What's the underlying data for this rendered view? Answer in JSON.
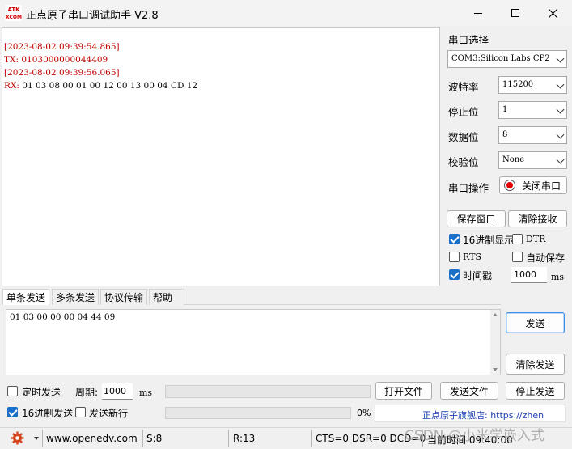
{
  "window": {
    "title": "正点原子串口调试助手 V2.8",
    "icon_text_top": "ATK",
    "icon_text_bottom": "XCOM"
  },
  "receive": {
    "lines": [
      {
        "text": "[2023-08-02 09:39:54.865]",
        "color": "#c00000"
      },
      {
        "text": "TX: 0103000000044409",
        "color": "#c00000"
      },
      {
        "text": "[2023-08-02 09:39:56.065]",
        "color": "#c00000"
      },
      {
        "text": "RX: 01 03 08 00 01 00 12 00 13 00 04 CD 12",
        "prefix": "RX:",
        "rest": " 01 03 08 00 01 00 12 00 13 00 04 CD 12"
      }
    ]
  },
  "settings": {
    "port_label": "串口选择",
    "port_value": "COM3:Silicon Labs CP2",
    "baud_label": "波特率",
    "baud_value": "115200",
    "stopbits_label": "停止位",
    "stopbits_value": "1",
    "databits_label": "数据位",
    "databits_value": "8",
    "parity_label": "校验位",
    "parity_value": "None",
    "port_op_label": "串口操作",
    "port_op_button": "关闭串口",
    "port_status_color": "#e00000"
  },
  "buttons": {
    "save_window": "保存窗口",
    "clear_receive": "清除接收",
    "send": "发送",
    "clear_send": "清除发送",
    "open_file": "打开文件",
    "send_file": "发送文件",
    "stop_send": "停止发送"
  },
  "options": {
    "hex_display": {
      "label": "16进制显示",
      "checked": true
    },
    "dtr": {
      "label": "DTR",
      "checked": false
    },
    "rts": {
      "label": "RTS",
      "checked": false
    },
    "auto_save": {
      "label": "自动保存",
      "checked": false
    },
    "timestamp": {
      "label": "时间戳",
      "checked": true
    },
    "timestamp_value": "1000",
    "timestamp_unit": "ms"
  },
  "tabs": [
    "单条发送",
    "多条发送",
    "协议传输",
    "帮助"
  ],
  "send": {
    "text": "01 03 00 00 00 04 44 09",
    "timed_send_label": "定时发送",
    "period_label": "周期:",
    "period_value": "1000",
    "period_unit": "ms",
    "hex_send_label": "16进制发送",
    "newline_label": "发送新行",
    "progress_text": "0%",
    "store_link": "正点原子旗舰店: https://zhen"
  },
  "statusbar": {
    "url": "www.openedv.com",
    "sent": "S:8",
    "received": "R:13",
    "signals": "CTS=0 DSR=0 DCD=0",
    "time": "当前时间 09:40:00"
  },
  "watermark": "CSDN @小米学嵌入式",
  "colors": {
    "accent": "#1a6fc9",
    "link": "#1a3fb0"
  }
}
